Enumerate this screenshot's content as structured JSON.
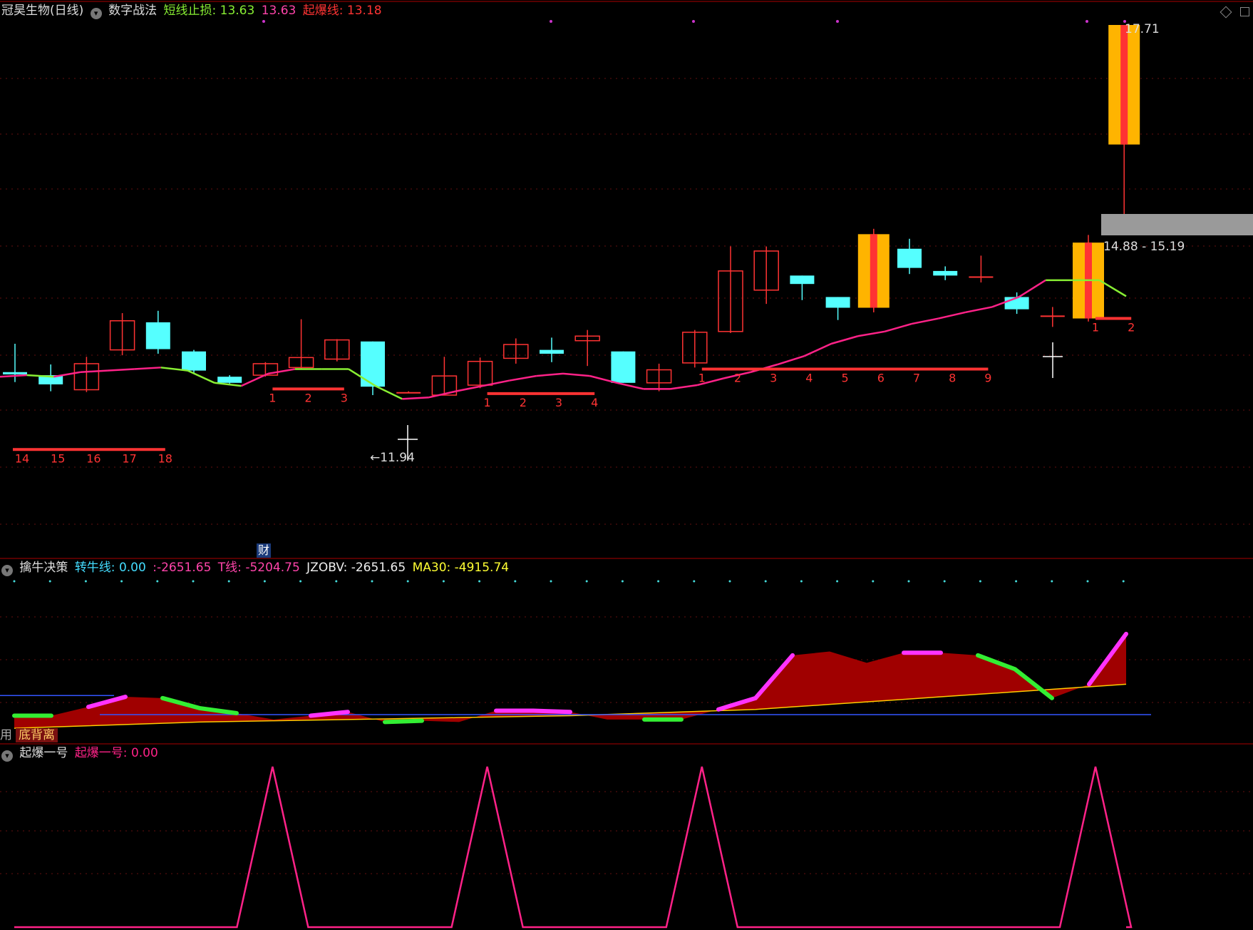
{
  "panel1": {
    "title": "冠昊生物(日线)",
    "indicator": "数字战法",
    "short_stop_label": "短线止损:",
    "short_stop_value": "13.63",
    "blank_value": "13.63",
    "burst_label": "起爆线:",
    "burst_value": "13.18",
    "high_label": "17.71",
    "low_label": "←11.94",
    "range_label": "14.88 - 15.19",
    "cai_label": "财"
  },
  "panel2": {
    "title": "擒牛决策",
    "turn_label": "转牛线:",
    "turn_value": "0.00",
    "blank_value": ":-2651.65",
    "t_label": "T线:",
    "t_value": "-5204.75",
    "jzobv_label": "JZOBV:",
    "jzobv_value": "-2651.65",
    "ma30_label": "MA30:",
    "ma30_value": "-4915.74",
    "side_label": "用",
    "diverge_label": "底背离"
  },
  "panel3": {
    "title": "起爆一号",
    "label": "起爆一号:",
    "value": "0.00"
  },
  "colors": {
    "up": "#ff3333",
    "down": "#55ffff",
    "green": "#88ee33",
    "magenta": "#ff2288",
    "yellow": "#ffcc00",
    "gold": "#ffb400",
    "gray": "#aaaaaa"
  },
  "chart_data": {
    "type": "candlestick",
    "candles": [
      {
        "o": 13.18,
        "h": 13.55,
        "l": 13.05,
        "c": 13.15
      },
      {
        "o": 13.14,
        "h": 13.28,
        "l": 12.93,
        "c": 13.02
      },
      {
        "o": 12.95,
        "h": 13.38,
        "l": 12.92,
        "c": 13.29
      },
      {
        "o": 13.47,
        "h": 13.95,
        "l": 13.4,
        "c": 13.85
      },
      {
        "o": 13.83,
        "h": 13.98,
        "l": 13.42,
        "c": 13.48
      },
      {
        "o": 13.45,
        "h": 13.47,
        "l": 13.17,
        "c": 13.2
      },
      {
        "o": 13.12,
        "h": 13.14,
        "l": 13.03,
        "c": 13.04
      },
      {
        "o": 13.14,
        "h": 13.31,
        "l": 13.12,
        "c": 13.29
      },
      {
        "o": 13.24,
        "h": 13.87,
        "l": 13.22,
        "c": 13.37
      },
      {
        "o": 13.35,
        "h": 13.61,
        "l": 13.32,
        "c": 13.6
      },
      {
        "o": 13.58,
        "h": 13.58,
        "l": 12.88,
        "c": 12.99
      },
      {
        "o": 12.91,
        "h": 12.93,
        "l": 12.91,
        "c": 12.91
      },
      {
        "o": 12.88,
        "h": 13.38,
        "l": 12.88,
        "c": 13.13
      },
      {
        "o": 13.01,
        "h": 13.37,
        "l": 12.97,
        "c": 13.32
      },
      {
        "o": 13.36,
        "h": 13.62,
        "l": 13.29,
        "c": 13.54
      },
      {
        "o": 13.47,
        "h": 13.63,
        "l": 13.31,
        "c": 13.42
      },
      {
        "o": 13.59,
        "h": 13.73,
        "l": 13.26,
        "c": 13.65
      },
      {
        "o": 13.45,
        "h": 13.45,
        "l": 13.04,
        "c": 13.04
      },
      {
        "o": 13.04,
        "h": 13.29,
        "l": 12.93,
        "c": 13.21
      },
      {
        "o": 13.3,
        "h": 13.73,
        "l": 13.24,
        "c": 13.7
      },
      {
        "o": 13.71,
        "h": 14.82,
        "l": 13.69,
        "c": 14.5
      },
      {
        "o": 14.25,
        "h": 14.82,
        "l": 14.07,
        "c": 14.76
      },
      {
        "o": 14.44,
        "h": 14.44,
        "l": 14.12,
        "c": 14.33
      },
      {
        "o": 14.16,
        "h": 14.16,
        "l": 13.86,
        "c": 14.02
      },
      {
        "o": 14.02,
        "h": 15.05,
        "l": 13.96,
        "c": 14.98
      },
      {
        "o": 14.79,
        "h": 14.92,
        "l": 14.46,
        "c": 14.54
      },
      {
        "o": 14.5,
        "h": 14.56,
        "l": 14.38,
        "c": 14.44
      },
      {
        "o": 14.42,
        "h": 14.7,
        "l": 14.35,
        "c": 14.42
      },
      {
        "o": 14.16,
        "h": 14.22,
        "l": 13.94,
        "c": 14.0
      },
      {
        "o": 13.91,
        "h": 14.03,
        "l": 13.77,
        "c": 13.91
      },
      {
        "o": 13.88,
        "h": 14.97,
        "l": 13.84,
        "c": 14.87
      },
      {
        "o": 16.15,
        "h": 17.71,
        "l": 15.19,
        "c": 17.71
      }
    ],
    "highlight_candles": [
      24,
      30,
      31
    ],
    "stop_line": [
      13.12,
      13.14,
      13.12,
      13.18,
      13.2,
      13.22,
      13.24,
      13.2,
      13.04,
      13.0,
      13.16,
      13.22,
      13.22,
      13.22,
      13.0,
      12.83,
      12.85,
      12.93,
      13.0,
      13.07,
      13.13,
      13.16,
      13.13,
      13.04,
      12.96,
      12.96,
      13.01,
      13.1,
      13.18,
      13.28,
      13.39,
      13.55,
      13.65,
      13.71,
      13.81,
      13.88,
      13.96,
      14.03,
      14.16,
      14.38,
      14.38,
      14.38,
      14.17
    ],
    "burst_segments": [
      {
        "from": 7,
        "to": 9,
        "value": 12.96,
        "labels": [
          "1",
          "2",
          "3"
        ]
      },
      {
        "from": 13,
        "to": 16,
        "value": 12.9,
        "labels": [
          "1",
          "2",
          "3",
          "4"
        ]
      },
      {
        "from": 19,
        "to": 27,
        "value": 13.22,
        "labels": [
          "1",
          "2",
          "3",
          "4",
          "5",
          "6",
          "7",
          "8",
          "9"
        ]
      },
      {
        "from": 30,
        "to": 31,
        "value": 13.88,
        "labels": [
          "1",
          "2"
        ]
      },
      {
        "from": 0,
        "to": 4,
        "value": 12.17,
        "labels": [
          "14",
          "15",
          "16",
          "17",
          "18"
        ]
      }
    ],
    "range_box": [
      14.88,
      15.19
    ],
    "obv_area": [
      -3150,
      -3150,
      -3080,
      -3000,
      -3010,
      -3090,
      -3130,
      -3180,
      -3150,
      -3120,
      -3200,
      -3190,
      -3200,
      -3110,
      -3110,
      -3120,
      -3180,
      -3180,
      -3180,
      -3100,
      -3010,
      -2670,
      -2640,
      -2730,
      -2650,
      -2650,
      -2670,
      -2780,
      -3010,
      -2900,
      -2500
    ],
    "obv_base": [
      -3250,
      -3240,
      -3230,
      -3220,
      -3210,
      -3200,
      -3195,
      -3190,
      -3185,
      -3180,
      -3175,
      -3170,
      -3165,
      -3160,
      -3155,
      -3150,
      -3140,
      -3130,
      -3120,
      -3110,
      -3100,
      -3080,
      -3060,
      -3040,
      -3020,
      -3000,
      -2980,
      -2960,
      -2940,
      -2920,
      -2900
    ],
    "obv_green_segments": [
      [
        0,
        1
      ],
      [
        4,
        6
      ],
      [
        10,
        11
      ],
      [
        17,
        18
      ],
      [
        26,
        28
      ]
    ],
    "obv_magenta_segments": [
      [
        2,
        3
      ],
      [
        8,
        9
      ],
      [
        13,
        15
      ],
      [
        19,
        21
      ],
      [
        24,
        25
      ],
      [
        29,
        30
      ]
    ],
    "obv_hline": -3120,
    "obv_hline2": -2990,
    "burst_peaks": [
      7,
      13,
      19,
      30
    ],
    "peak_value": 1,
    "xlabel": "",
    "ylabel": ""
  }
}
